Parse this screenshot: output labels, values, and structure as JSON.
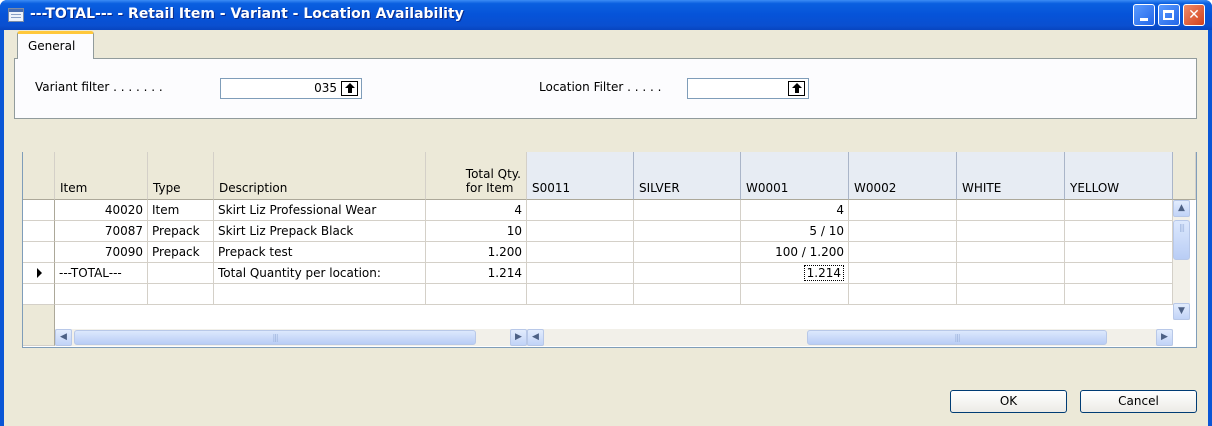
{
  "window": {
    "title": "---TOTAL--- - Retail Item - Variant - Location Availability",
    "minimize_icon": "minimize-icon",
    "maximize_icon": "maximize-icon",
    "close_icon": "close-icon"
  },
  "tabs": [
    {
      "label": "General"
    }
  ],
  "filters": {
    "variant_label": "Variant filter . . . . . . .",
    "variant_value": "035",
    "location_label": "Location Filter . . . . .",
    "location_value": ""
  },
  "grid": {
    "columns": {
      "item": "Item",
      "type": "Type",
      "description": "Description",
      "total_qty": "Total Qty.\nfor Item",
      "locations": [
        "S0011",
        "SILVER",
        "W0001",
        "W0002",
        "WHITE",
        "YELLOW"
      ]
    },
    "rows": [
      {
        "item": "40020",
        "type": "Item",
        "description": "Skirt Liz Professional Wear",
        "total": "4",
        "locs": [
          "",
          "",
          "4",
          "",
          "",
          ""
        ]
      },
      {
        "item": "70087",
        "type": "Prepack",
        "description": "Skirt Liz Prepack Black",
        "total": "10",
        "locs": [
          "",
          "",
          "5 / 10",
          "",
          "",
          ""
        ]
      },
      {
        "item": "70090",
        "type": "Prepack",
        "description": "Prepack test",
        "total": "1.200",
        "locs": [
          "",
          "",
          "100 / 1.200",
          "",
          "",
          ""
        ]
      },
      {
        "item": "---TOTAL---",
        "type": "",
        "description": "Total Quantity per location:",
        "total": "1.214",
        "locs": [
          "",
          "",
          "1.214",
          "",
          "",
          ""
        ]
      }
    ]
  },
  "buttons": {
    "ok": "OK",
    "cancel": "Cancel"
  }
}
